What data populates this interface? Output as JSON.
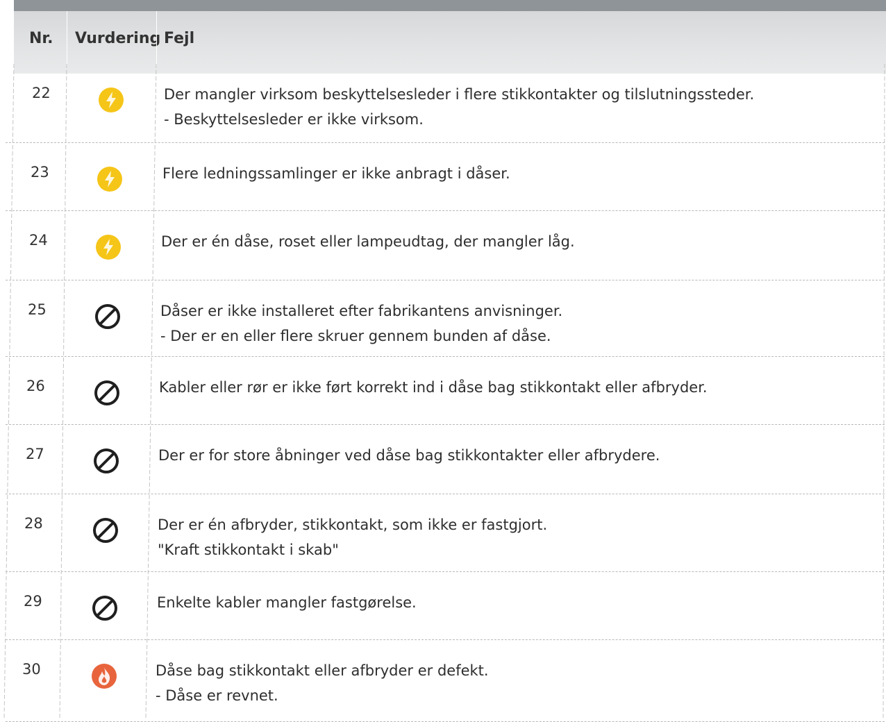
{
  "table": {
    "headers": {
      "nr": "Nr.",
      "vurdering": "Vurdering",
      "fejl": "Fejl"
    },
    "rows": [
      {
        "nr": "22",
        "rating": "lightning-icon",
        "lines": [
          "Der mangler virksom beskyttelsesleder i flere stikkontakter og tilslutningssteder.",
          "- Beskyttelsesleder er ikke virksom."
        ]
      },
      {
        "nr": "23",
        "rating": "lightning-icon",
        "lines": [
          "Flere ledningssamlinger er ikke anbragt i dåser."
        ]
      },
      {
        "nr": "24",
        "rating": "lightning-icon",
        "lines": [
          "Der er én dåse, roset eller lampeudtag, der mangler låg."
        ]
      },
      {
        "nr": "25",
        "rating": "prohibited-icon",
        "lines": [
          "Dåser er ikke installeret efter fabrikantens anvisninger.",
          "- Der er en eller flere skruer gennem bunden af dåse."
        ]
      },
      {
        "nr": "26",
        "rating": "prohibited-icon",
        "lines": [
          "Kabler eller rør er ikke ført korrekt ind i dåse bag stikkontakt eller afbryder."
        ]
      },
      {
        "nr": "27",
        "rating": "prohibited-icon",
        "lines": [
          "Der er for store åbninger ved dåse bag stikkontakter eller afbrydere."
        ]
      },
      {
        "nr": "28",
        "rating": "prohibited-icon",
        "lines": [
          "Der er én afbryder, stikkontakt, som ikke er fastgjort.",
          "\"Kraft stikkontakt i skab\""
        ]
      },
      {
        "nr": "29",
        "rating": "prohibited-icon",
        "lines": [
          "Enkelte kabler mangler fastgørelse."
        ]
      },
      {
        "nr": "30",
        "rating": "fire-icon",
        "lines": [
          "Dåse bag stikkontakt eller afbryder er defekt.",
          "- Dåse er revnet."
        ]
      }
    ]
  },
  "colors": {
    "lightning": "#f5c518",
    "fire": "#e8643c",
    "prohibited": "#1f1f1f",
    "header_bg": "#dfe0e1"
  }
}
